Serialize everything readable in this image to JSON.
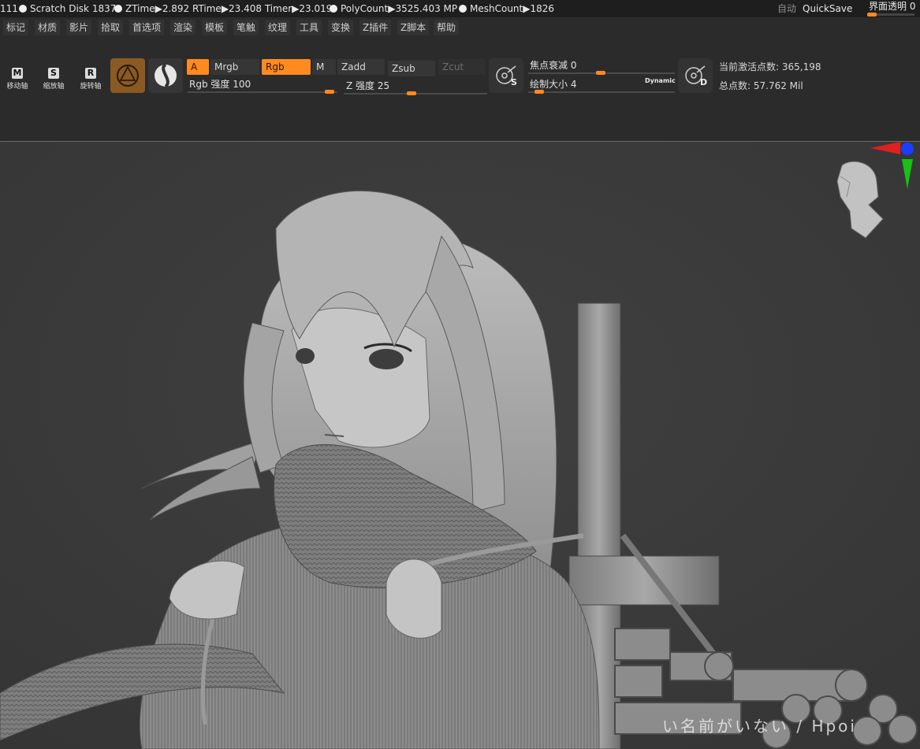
{
  "status": {
    "prefix": "111",
    "scratch_disk": "Scratch Disk 1837",
    "ztime": "ZTime▶2.892 RTime▶23.408 Timer▶23.019",
    "polycount": "PolyCount▶3525.403 MP",
    "meshcount": "MeshCount▶1826",
    "auto_label": "自动",
    "quicksave_label": "QuickSave",
    "ui_transparency_label": "界面透明 0"
  },
  "menu": [
    "标记",
    "材质",
    "影片",
    "拾取",
    "首选项",
    "渲染",
    "模板",
    "笔触",
    "纹理",
    "工具",
    "变换",
    "Z插件",
    "Z脚本",
    "帮助"
  ],
  "toolbar": {
    "move_key": "M",
    "move_label": "移动轴",
    "scale_key": "S",
    "scale_label": "缩放轴",
    "rotate_key": "R",
    "rotate_label": "旋转轴",
    "a_label": "A",
    "mrgb_label": "Mrgb",
    "rgb_label": "Rgb",
    "m_label": "M",
    "zadd_label": "Zadd",
    "zsub_label": "Zsub",
    "zcut_label": "Zcut",
    "rgb_intensity_label": "Rgb 强度 100",
    "z_intensity_label": "Z 强度 25",
    "focal_shift_label": "焦点衰减 0",
    "draw_size_label": "绘制大小 4",
    "dynamic_label": "Dynamic",
    "s_key": "S",
    "d_key": "D",
    "active_points_label": "当前激活点数: 365,198",
    "total_points_label": "总点数: 57.762 Mil"
  },
  "sliders": {
    "rgb_intensity": 100,
    "z_intensity": 25,
    "focal_shift": 0,
    "draw_size": 4,
    "ui_transparency": 0
  },
  "viewport": {
    "watermark": "い名前がいない / Hpoi"
  },
  "colors": {
    "accent": "#ff8a1f",
    "axis_x": "#e02020",
    "axis_y": "#18c018",
    "axis_z": "#1c3cff"
  }
}
